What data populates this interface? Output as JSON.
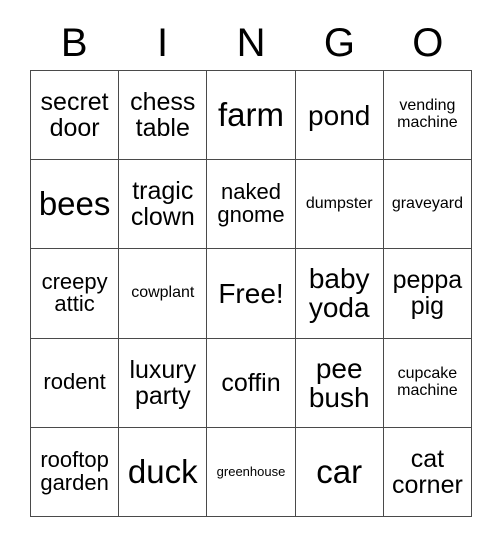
{
  "card": {
    "title": "BINGO",
    "header_letters": [
      "B",
      "I",
      "N",
      "G",
      "O"
    ],
    "colors": {
      "background": "#ffffff",
      "grid_line": "#4a4a4a",
      "text": "#000000"
    },
    "rows": [
      [
        {
          "label": "secret door",
          "size": "md"
        },
        {
          "label": "chess table",
          "size": "md"
        },
        {
          "label": "farm",
          "size": "xl"
        },
        {
          "label": "pond",
          "size": "lg"
        },
        {
          "label": "vending machine",
          "size": "xs"
        }
      ],
      [
        {
          "label": "bees",
          "size": "xl"
        },
        {
          "label": "tragic clown",
          "size": "md"
        },
        {
          "label": "naked gnome",
          "size": "sm"
        },
        {
          "label": "dumpster",
          "size": "xs"
        },
        {
          "label": "graveyard",
          "size": "xs"
        }
      ],
      [
        {
          "label": "creepy attic",
          "size": "sm"
        },
        {
          "label": "cowplant",
          "size": "xs"
        },
        {
          "label": "Free!",
          "size": "lg"
        },
        {
          "label": "baby yoda",
          "size": "lg"
        },
        {
          "label": "peppa pig",
          "size": "md"
        }
      ],
      [
        {
          "label": "rodent",
          "size": "sm"
        },
        {
          "label": "luxury party",
          "size": "md"
        },
        {
          "label": "coffin",
          "size": "md"
        },
        {
          "label": "pee bush",
          "size": "lg"
        },
        {
          "label": "cupcake machine",
          "size": "xs"
        }
      ],
      [
        {
          "label": "rooftop garden",
          "size": "sm"
        },
        {
          "label": "duck",
          "size": "xl"
        },
        {
          "label": "greenhouse",
          "size": "xxs"
        },
        {
          "label": "car",
          "size": "xl"
        },
        {
          "label": "cat corner",
          "size": "md"
        }
      ]
    ]
  }
}
